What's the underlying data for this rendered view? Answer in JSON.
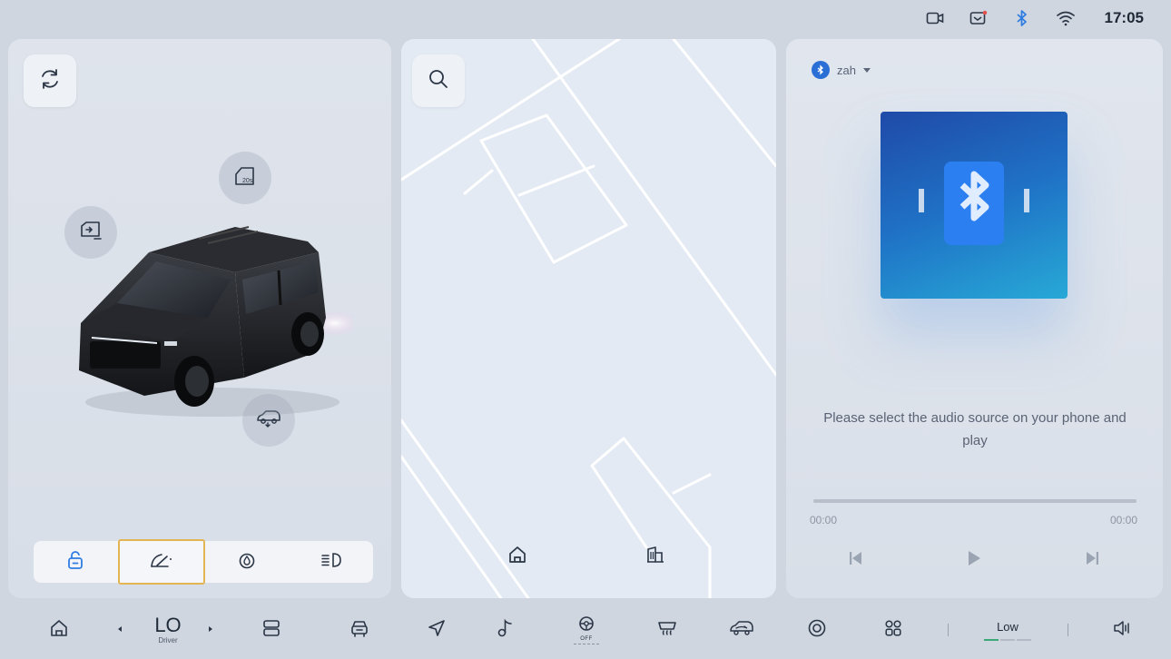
{
  "status": {
    "time": "17:05",
    "icons": [
      "camera-icon",
      "message-icon",
      "bluetooth-icon",
      "wifi-icon"
    ],
    "bluetooth_color": "#2f7de1"
  },
  "vehicle_panel": {
    "icons": [
      "refresh-icon",
      "door-timer-icon",
      "window-icon",
      "trunk-icon"
    ],
    "door_timer_text": "20s",
    "quick_controls": [
      "lock-icon",
      "wiper-icon",
      "fuel-icon",
      "headlight-icon"
    ],
    "active_quick_index": 1,
    "active_color": "#e2b552",
    "lock_color": "#2f7de1"
  },
  "map_panel": {
    "icons": [
      "search-icon",
      "home-icon",
      "company-icon"
    ]
  },
  "media_panel": {
    "source_name": "zah",
    "hint": "Please select the audio source on your phone and play",
    "time_start": "00:00",
    "time_end": "00:00",
    "progress": 0,
    "controls": [
      "previous-icon",
      "play-icon",
      "next-icon"
    ]
  },
  "dock": {
    "temperature": "LO",
    "zone": "Driver",
    "fan_level": "Low",
    "steering_heat_label": "OFF",
    "items": [
      "home-icon",
      "temp-down-icon",
      "temp-up-icon",
      "seat-control-icon",
      "car-icon",
      "navigation-icon",
      "music-icon",
      "steering-heat-icon",
      "rear-defrost-icon",
      "air-circulation-icon",
      "camera-360-icon",
      "apps-icon",
      "volume-icon"
    ]
  }
}
